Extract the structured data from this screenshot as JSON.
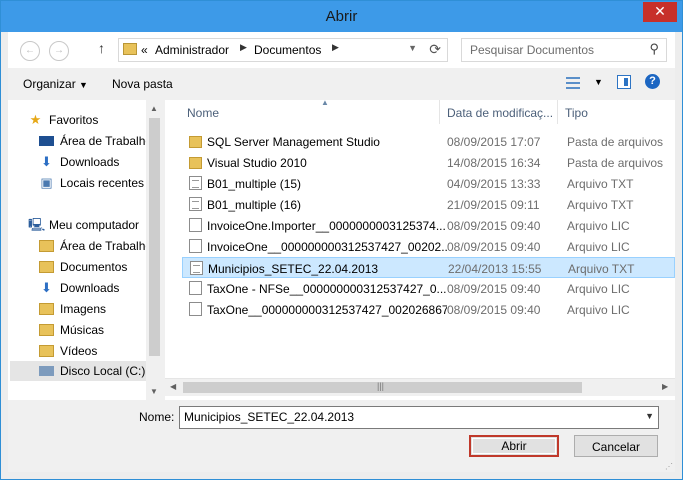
{
  "window": {
    "title": "Abrir",
    "close_glyph": "✕"
  },
  "nav": {
    "back_icon": "←",
    "forward_icon": "→",
    "up_icon": "↑",
    "address": {
      "overflow": "«",
      "crumbs": [
        "Administrador",
        "Documentos"
      ]
    },
    "search_placeholder": "Pesquisar Documentos"
  },
  "toolbar": {
    "organize_label": "Organizar",
    "new_folder_label": "Nova pasta"
  },
  "sidebar": {
    "favorites_label": "Favoritos",
    "favorites": [
      "Área de Trabalho",
      "Downloads",
      "Locais recentes"
    ],
    "computer_label": "Meu computador",
    "computer": [
      "Área de Trabalho",
      "Documentos",
      "Downloads",
      "Imagens",
      "Músicas",
      "Vídeos",
      "Disco Local (C:)"
    ]
  },
  "columns": {
    "name": "Nome",
    "date": "Data de modificaç...",
    "type": "Tipo"
  },
  "files": [
    {
      "name": "SQL Server Management Studio",
      "date": "08/09/2015 17:07",
      "type": "Pasta de arquivos",
      "icon": "folder"
    },
    {
      "name": "Visual Studio 2010",
      "date": "14/08/2015 16:34",
      "type": "Pasta de arquivos",
      "icon": "folder"
    },
    {
      "name": "B01_multiple (15)",
      "date": "04/09/2015 13:33",
      "type": "Arquivo TXT",
      "icon": "txt"
    },
    {
      "name": "B01_multiple (16)",
      "date": "21/09/2015 09:11",
      "type": "Arquivo TXT",
      "icon": "txt"
    },
    {
      "name": "InvoiceOne.Importer__0000000003125374...",
      "date": "08/09/2015 09:40",
      "type": "Arquivo LIC",
      "icon": "doc"
    },
    {
      "name": "InvoiceOne__000000000312537427_00202...",
      "date": "08/09/2015 09:40",
      "type": "Arquivo LIC",
      "icon": "doc"
    },
    {
      "name": "Municipios_SETEC_22.04.2013",
      "date": "22/04/2013 15:55",
      "type": "Arquivo TXT",
      "icon": "txt"
    },
    {
      "name": "TaxOne - NFSe__000000000312537427_0...",
      "date": "08/09/2015 09:40",
      "type": "Arquivo LIC",
      "icon": "doc"
    },
    {
      "name": "TaxOne__000000000312537427_002026867...",
      "date": "08/09/2015 09:40",
      "type": "Arquivo LIC",
      "icon": "doc"
    }
  ],
  "filename": {
    "label": "Nome:",
    "value": "Municipios_SETEC_22.04.2013"
  },
  "buttons": {
    "open": "Abrir",
    "cancel": "Cancelar"
  }
}
